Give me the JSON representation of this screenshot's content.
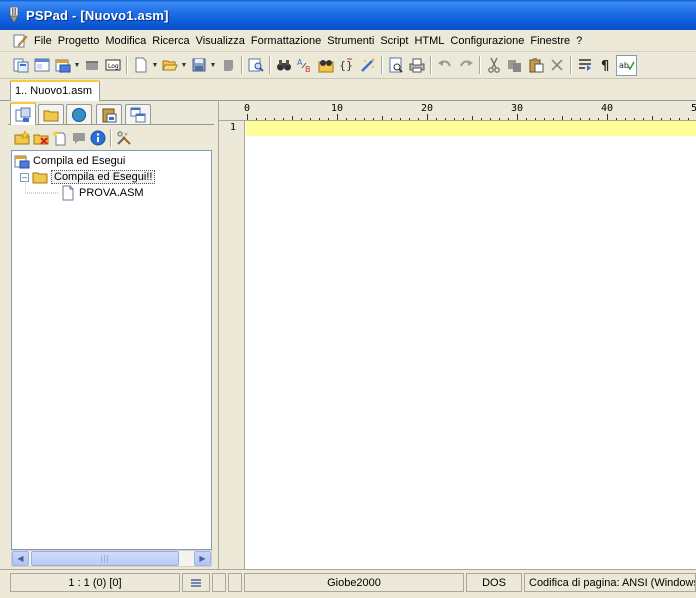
{
  "window": {
    "title": "PSPad - [Nuovo1.asm]"
  },
  "menu": {
    "items": [
      "File",
      "Progetto",
      "Modifica",
      "Ricerca",
      "Visualizza",
      "Formattazione",
      "Strumenti",
      "Script",
      "HTML",
      "Configurazione",
      "Finestre",
      "?"
    ]
  },
  "toolbar": {
    "buttons": [
      "project-icon",
      "properties-icon",
      "new-project-icon",
      "minimize-icon",
      "log-icon",
      "new-file-icon",
      "open-file-icon",
      "save-icon",
      "save-all-icon",
      "print-preview-icon",
      "binoculars-icon",
      "find-replace-icon",
      "find-in-files-icon",
      "bracket-icon",
      "spellcheck-icon",
      "preview-icon",
      "print-icon",
      "undo-icon",
      "redo-icon",
      "cut-icon",
      "copy-icon",
      "paste-icon",
      "delete-icon",
      "word-wrap-icon",
      "pilcrow-icon",
      "spell-icon"
    ]
  },
  "document_tabs": [
    {
      "label": "1.. Nuovo1.asm",
      "active": true
    }
  ],
  "project_panel": {
    "tabs": [
      "project-tab-icon",
      "folder-tab-icon",
      "globe-tab-icon",
      "clipboard-tab-icon",
      "windows-tab-icon"
    ],
    "tree": {
      "root": "Compila ed Esegui",
      "folder": "Compila ed Esegui!!",
      "file": "PROVA.ASM"
    }
  },
  "editor": {
    "ruler_labels": [
      "0",
      "10",
      "20",
      "30",
      "40",
      "5"
    ],
    "line_numbers": [
      "1"
    ],
    "current_line_color": "#ffff99"
  },
  "status": {
    "position": "1 : 1  (0)  [0]",
    "user": "Giobe2000",
    "line_endings": "DOS",
    "encoding": "Codifica di pagina: ANSI (Windows)"
  }
}
